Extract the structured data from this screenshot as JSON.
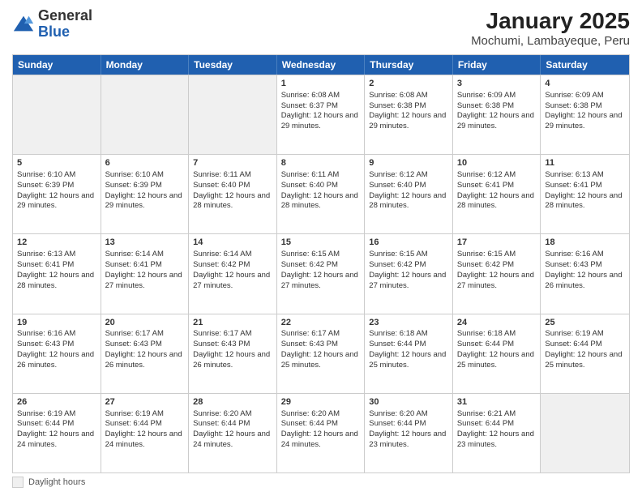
{
  "header": {
    "logo_general": "General",
    "logo_blue": "Blue",
    "title": "January 2025",
    "subtitle": "Mochumi, Lambayeque, Peru"
  },
  "calendar": {
    "days_of_week": [
      "Sunday",
      "Monday",
      "Tuesday",
      "Wednesday",
      "Thursday",
      "Friday",
      "Saturday"
    ],
    "weeks": [
      [
        {
          "day": "",
          "info": ""
        },
        {
          "day": "",
          "info": ""
        },
        {
          "day": "",
          "info": ""
        },
        {
          "day": "1",
          "info": "Sunrise: 6:08 AM\nSunset: 6:37 PM\nDaylight: 12 hours and 29 minutes."
        },
        {
          "day": "2",
          "info": "Sunrise: 6:08 AM\nSunset: 6:38 PM\nDaylight: 12 hours and 29 minutes."
        },
        {
          "day": "3",
          "info": "Sunrise: 6:09 AM\nSunset: 6:38 PM\nDaylight: 12 hours and 29 minutes."
        },
        {
          "day": "4",
          "info": "Sunrise: 6:09 AM\nSunset: 6:38 PM\nDaylight: 12 hours and 29 minutes."
        }
      ],
      [
        {
          "day": "5",
          "info": "Sunrise: 6:10 AM\nSunset: 6:39 PM\nDaylight: 12 hours and 29 minutes."
        },
        {
          "day": "6",
          "info": "Sunrise: 6:10 AM\nSunset: 6:39 PM\nDaylight: 12 hours and 29 minutes."
        },
        {
          "day": "7",
          "info": "Sunrise: 6:11 AM\nSunset: 6:40 PM\nDaylight: 12 hours and 28 minutes."
        },
        {
          "day": "8",
          "info": "Sunrise: 6:11 AM\nSunset: 6:40 PM\nDaylight: 12 hours and 28 minutes."
        },
        {
          "day": "9",
          "info": "Sunrise: 6:12 AM\nSunset: 6:40 PM\nDaylight: 12 hours and 28 minutes."
        },
        {
          "day": "10",
          "info": "Sunrise: 6:12 AM\nSunset: 6:41 PM\nDaylight: 12 hours and 28 minutes."
        },
        {
          "day": "11",
          "info": "Sunrise: 6:13 AM\nSunset: 6:41 PM\nDaylight: 12 hours and 28 minutes."
        }
      ],
      [
        {
          "day": "12",
          "info": "Sunrise: 6:13 AM\nSunset: 6:41 PM\nDaylight: 12 hours and 28 minutes."
        },
        {
          "day": "13",
          "info": "Sunrise: 6:14 AM\nSunset: 6:41 PM\nDaylight: 12 hours and 27 minutes."
        },
        {
          "day": "14",
          "info": "Sunrise: 6:14 AM\nSunset: 6:42 PM\nDaylight: 12 hours and 27 minutes."
        },
        {
          "day": "15",
          "info": "Sunrise: 6:15 AM\nSunset: 6:42 PM\nDaylight: 12 hours and 27 minutes."
        },
        {
          "day": "16",
          "info": "Sunrise: 6:15 AM\nSunset: 6:42 PM\nDaylight: 12 hours and 27 minutes."
        },
        {
          "day": "17",
          "info": "Sunrise: 6:15 AM\nSunset: 6:42 PM\nDaylight: 12 hours and 27 minutes."
        },
        {
          "day": "18",
          "info": "Sunrise: 6:16 AM\nSunset: 6:43 PM\nDaylight: 12 hours and 26 minutes."
        }
      ],
      [
        {
          "day": "19",
          "info": "Sunrise: 6:16 AM\nSunset: 6:43 PM\nDaylight: 12 hours and 26 minutes."
        },
        {
          "day": "20",
          "info": "Sunrise: 6:17 AM\nSunset: 6:43 PM\nDaylight: 12 hours and 26 minutes."
        },
        {
          "day": "21",
          "info": "Sunrise: 6:17 AM\nSunset: 6:43 PM\nDaylight: 12 hours and 26 minutes."
        },
        {
          "day": "22",
          "info": "Sunrise: 6:17 AM\nSunset: 6:43 PM\nDaylight: 12 hours and 25 minutes."
        },
        {
          "day": "23",
          "info": "Sunrise: 6:18 AM\nSunset: 6:44 PM\nDaylight: 12 hours and 25 minutes."
        },
        {
          "day": "24",
          "info": "Sunrise: 6:18 AM\nSunset: 6:44 PM\nDaylight: 12 hours and 25 minutes."
        },
        {
          "day": "25",
          "info": "Sunrise: 6:19 AM\nSunset: 6:44 PM\nDaylight: 12 hours and 25 minutes."
        }
      ],
      [
        {
          "day": "26",
          "info": "Sunrise: 6:19 AM\nSunset: 6:44 PM\nDaylight: 12 hours and 24 minutes."
        },
        {
          "day": "27",
          "info": "Sunrise: 6:19 AM\nSunset: 6:44 PM\nDaylight: 12 hours and 24 minutes."
        },
        {
          "day": "28",
          "info": "Sunrise: 6:20 AM\nSunset: 6:44 PM\nDaylight: 12 hours and 24 minutes."
        },
        {
          "day": "29",
          "info": "Sunrise: 6:20 AM\nSunset: 6:44 PM\nDaylight: 12 hours and 24 minutes."
        },
        {
          "day": "30",
          "info": "Sunrise: 6:20 AM\nSunset: 6:44 PM\nDaylight: 12 hours and 23 minutes."
        },
        {
          "day": "31",
          "info": "Sunrise: 6:21 AM\nSunset: 6:44 PM\nDaylight: 12 hours and 23 minutes."
        },
        {
          "day": "",
          "info": ""
        }
      ]
    ]
  },
  "legend": {
    "label": "Daylight hours"
  }
}
